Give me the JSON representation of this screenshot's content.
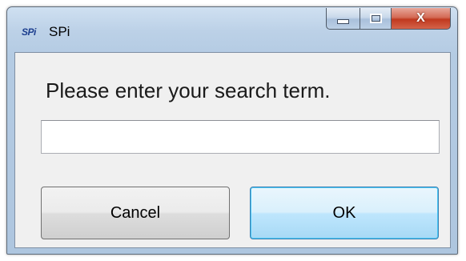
{
  "window": {
    "app_icon_text": "SPi",
    "title": "SPi"
  },
  "dialog": {
    "prompt": "Please enter your search term.",
    "search_value": "",
    "cancel_label": "Cancel",
    "ok_label": "OK"
  },
  "caption": {
    "close_glyph": "X"
  },
  "colors": {
    "close_button": "#c0391f",
    "ok_button_focus": "#48c8f6",
    "frame": "#b4cbe3"
  }
}
